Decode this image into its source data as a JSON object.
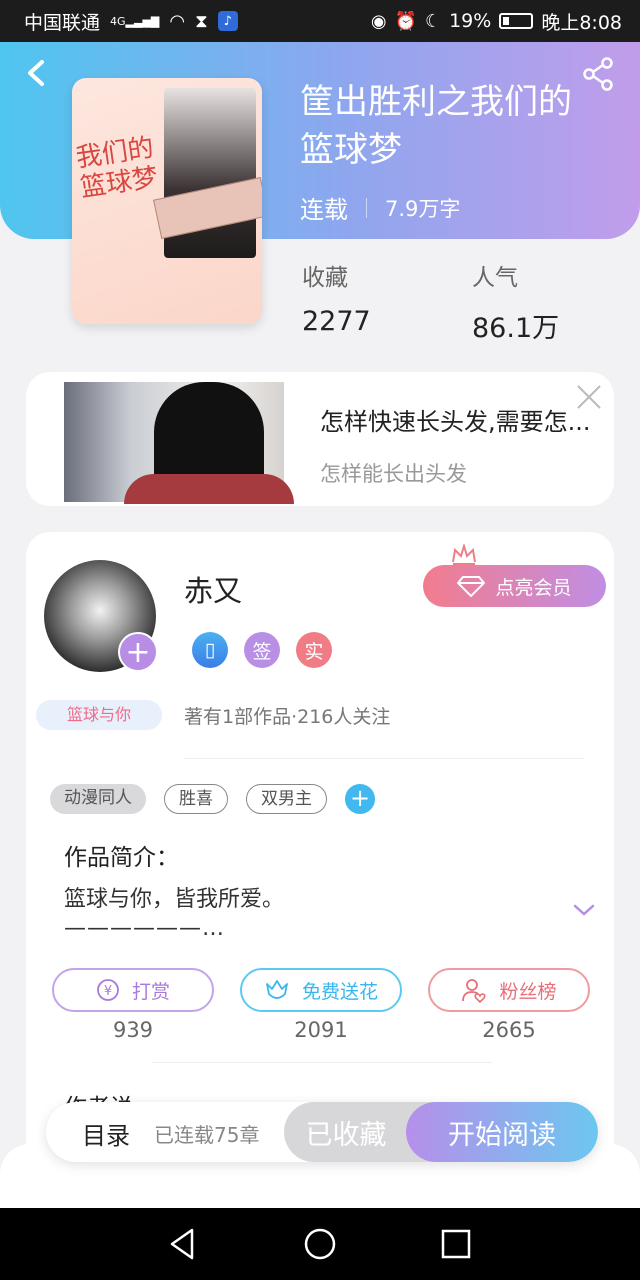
{
  "status_bar": {
    "carrier": "中国联通",
    "network": "4G",
    "battery": "19%",
    "time": "晚上8:08"
  },
  "book": {
    "title": "筐出胜利之我们的篮球梦",
    "status": "连载",
    "word_count": "7.9万字",
    "cover_title": "我们的篮球梦",
    "favorites_label": "收藏",
    "favorites_value": "2277",
    "popularity_label": "人气",
    "popularity_value": "86.1万"
  },
  "ad": {
    "title": "怎样快速长头发,需要怎...",
    "subtitle": "怎样能长出头发"
  },
  "author": {
    "name": "赤又",
    "vip_label": "点亮会员",
    "badge_sign": "签",
    "badge_real": "实",
    "book_tag": "篮球与你",
    "stats": "著有1部作品·216人关注"
  },
  "tags": [
    "动漫同人",
    "胜喜",
    "双男主"
  ],
  "intro": {
    "heading": "作品简介：",
    "text": "篮球与你，皆我所爱。",
    "more": "——————…"
  },
  "actions": {
    "tip_label": "打赏",
    "tip_count": "939",
    "flower_label": "免费送花",
    "flower_count": "2091",
    "fans_label": "粉丝榜",
    "fans_count": "2665"
  },
  "more_row": "作者说",
  "bottom": {
    "toc_label": "目录",
    "chapters": "已连载75章",
    "fav_label": "已收藏",
    "read_label": "开始阅读"
  },
  "colors": {
    "accent_blue": "#4fc6ef",
    "accent_purple": "#c19deb",
    "vip_pink": "#f27c8e"
  }
}
